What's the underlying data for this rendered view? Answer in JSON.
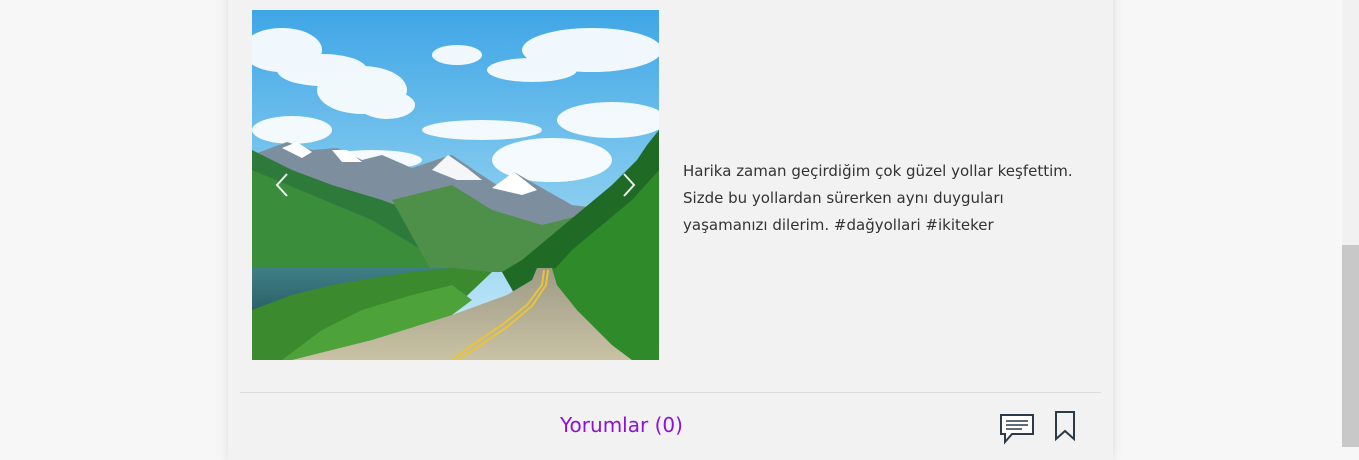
{
  "post": {
    "caption_line1": "Harika zaman geçirdiğim çok güzel yollar keşfettim.",
    "caption_line2": "Sizde bu yollardan sürerken aynı duyguları",
    "caption_line3": "yaşamanızı dilerim. #dağyollari #ikiteker"
  },
  "slider": {
    "prev_icon": "chevron-left-icon",
    "next_icon": "chevron-right-icon"
  },
  "footer": {
    "comments_label": "Yorumlar (0)",
    "comment_icon": "speech-bubble-icon",
    "bookmark_icon": "bookmark-icon"
  },
  "colors": {
    "accent": "#8c12d6",
    "text": "#333333",
    "card": "#f2f2f2"
  }
}
